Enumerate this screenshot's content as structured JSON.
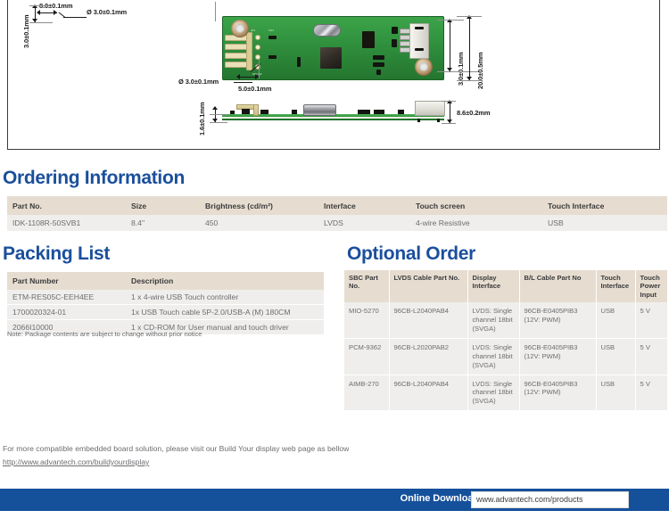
{
  "drawing": {
    "dimensions": {
      "hole_left_offset": "8.0±0.1mm",
      "edge_top_left": "3.0±0.1mm",
      "hole_dia_top": "Ø 3.0±0.1mm",
      "hole_dia_bottom": "Ø 3.0±0.1mm",
      "hole_right_offset": "5.0±0.1mm",
      "edge_right_inner": "3.0±0.1mm",
      "board_height": "20.0±0.5mm",
      "board_thickness": "1.6±0.1mm",
      "connector_height": "8.6±0.2mm"
    },
    "silkscreen": {
      "left_top_1": "JP1",
      "left_top_2": "CN1",
      "left_bottom": "SW  SW"
    }
  },
  "ordering": {
    "title": "Ordering Information",
    "headers": [
      "Part No.",
      "Size",
      "Brightness (cd/m²)",
      "Interface",
      "Touch screen",
      "Touch Interface"
    ],
    "rows": [
      [
        "IDK-1108R-50SVB1",
        "8.4\"",
        "450",
        "LVDS",
        "4-wire Resistive",
        "USB"
      ]
    ]
  },
  "packing": {
    "title": "Packing List",
    "headers": [
      "Part Number",
      "Description"
    ],
    "rows": [
      [
        "ETM-RES05C-EEH4EE",
        "1 x 4-wire USB Touch controller"
      ],
      [
        "1700020324-01",
        "1x USB Touch cable 5P-2.0/USB-A (M) 180CM"
      ],
      [
        "2066I10000",
        "1 x CD-ROM for User manual and touch driver"
      ]
    ],
    "note": "Note: Package contents are subject to change without prior notice"
  },
  "optional": {
    "title": "Optional Order",
    "headers": [
      "SBC Part No.",
      "LVDS Cable Part No.",
      "Display Interface",
      "B/L Cable Part No",
      "Touch Interface",
      "Touch Power Input"
    ],
    "rows": [
      [
        "MIO-5270",
        "96CB-L2040PAB4",
        "LVDS: Single channel 18bit (SVGA)",
        "96CB-E0405PIB3 (12V: PWM)",
        "USB",
        "5 V"
      ],
      [
        "PCM-9362",
        "96CB-L2020PAB2",
        "LVDS: Single channel 18bit (SVGA)",
        "96CB-E0405PIB3 (12V: PWM)",
        "USB",
        "5 V"
      ],
      [
        "AIMB-270",
        "96CB-L2040PAB4",
        "LVDS: Single channel 18bit (SVGA)",
        "96CB-E0405PIB3 (12V: PWM)",
        "USB",
        "5 V"
      ]
    ]
  },
  "footer": {
    "text": "For more compatible embedded board solution, please visit our Build Your display web page as bellow",
    "link": "http://www.advantech.com/buildyourdisplay",
    "download_label": "Online Download",
    "download_url": "www.advantech.com/products"
  },
  "colors": {
    "heading_blue": "#1b4f9c",
    "bar_blue": "#15509b",
    "table_header_bg": "#e6ddd0",
    "table_row_bg": "#efeeec"
  }
}
